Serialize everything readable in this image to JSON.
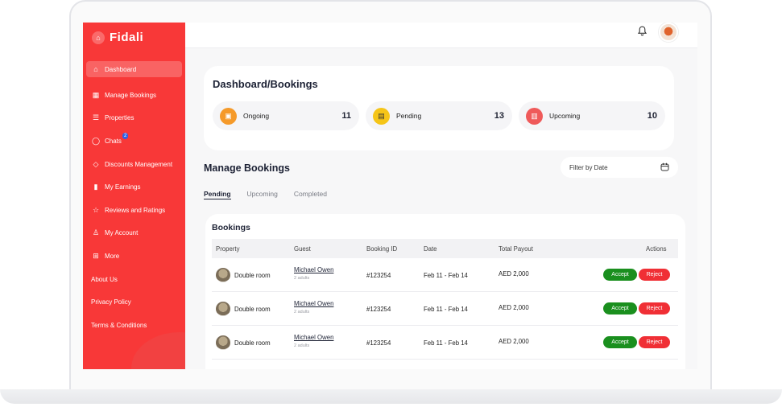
{
  "brand": {
    "name": "Fidali",
    "color": "#f83838"
  },
  "sidebar": {
    "items": [
      {
        "label": "Dashboard",
        "icon": "home-icon",
        "glyph": "⌂"
      },
      {
        "label": "Manage Bookings",
        "icon": "grid-icon",
        "glyph": "▦"
      },
      {
        "label": "Properties",
        "icon": "list-icon",
        "glyph": "☰"
      },
      {
        "label": "Chats",
        "icon": "chat-icon",
        "glyph": "◯",
        "badge": "2"
      },
      {
        "label": "Discounts Management",
        "icon": "tag-icon",
        "glyph": "◇"
      },
      {
        "label": "My Earnings",
        "icon": "bar-chart-icon",
        "glyph": "▮"
      },
      {
        "label": "Reviews and Ratings",
        "icon": "star-icon",
        "glyph": "☆"
      },
      {
        "label": "My Account",
        "icon": "user-icon",
        "glyph": "♙"
      },
      {
        "label": "More",
        "icon": "plus-square-icon",
        "glyph": "⊞"
      }
    ],
    "links": [
      "About Us",
      "Privacy Policy",
      "Terms & Conditions"
    ]
  },
  "topbar": {
    "bell_icon": "bell-icon",
    "avatar": "user-avatar"
  },
  "summary": {
    "title": "Dashboard/Bookings",
    "stats": [
      {
        "label": "Ongoing",
        "value": "11",
        "icon": "ongoing-icon",
        "color": "#f59a2a"
      },
      {
        "label": "Pending",
        "value": "13",
        "icon": "pending-icon",
        "color": "#f5c518"
      },
      {
        "label": "Upcoming",
        "value": "10",
        "icon": "upcoming-icon",
        "color": "#ef5a5a"
      }
    ]
  },
  "manage": {
    "title": "Manage Bookings",
    "filter_label": "Filter by Date",
    "tabs": [
      "Pending",
      "Upcoming",
      "Completed"
    ]
  },
  "bookings": {
    "title": "Bookings",
    "headers": {
      "property": "Property",
      "guest": "Guest",
      "booking_id": "Booking ID",
      "date": "Date",
      "payout": "Total Payout",
      "actions": "Actions"
    },
    "rows": [
      {
        "property": "Double room",
        "guest": "Michael Owen",
        "guest_sub": "2 adults",
        "booking_id": "#123254",
        "date": "Feb 11 - Feb 14",
        "payout": "AED 2,000",
        "accept": "Accept",
        "reject": "Reject"
      },
      {
        "property": "Double room",
        "guest": "Michael Owen",
        "guest_sub": "2 adults",
        "booking_id": "#123254",
        "date": "Feb 11 - Feb 14",
        "payout": "AED 2,000",
        "accept": "Accept",
        "reject": "Reject"
      },
      {
        "property": "Double room",
        "guest": "Michael Owen",
        "guest_sub": "2 adults",
        "booking_id": "#123254",
        "date": "Feb 11 - Feb 14",
        "payout": "AED 2,000",
        "accept": "Accept",
        "reject": "Reject"
      }
    ]
  }
}
